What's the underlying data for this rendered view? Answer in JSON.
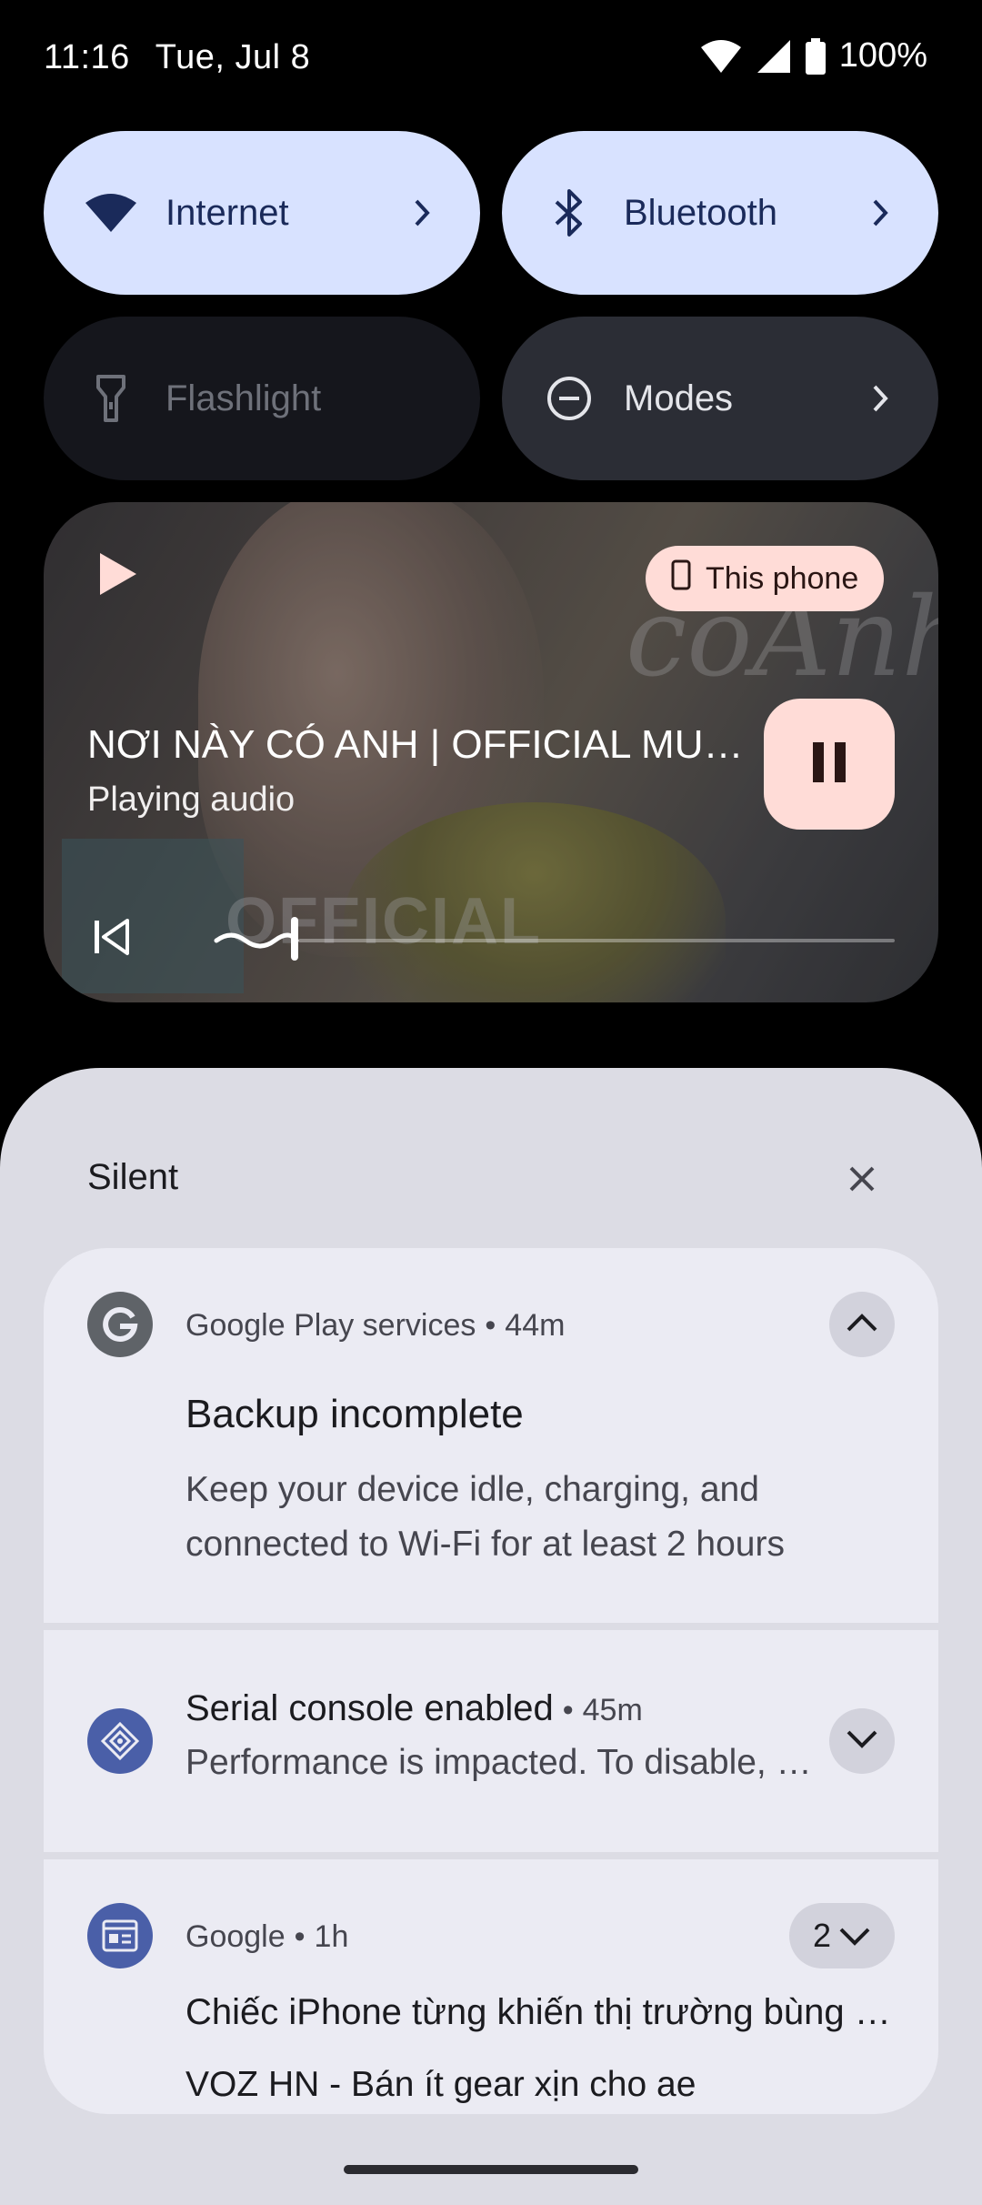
{
  "status_bar": {
    "time": "11:16",
    "date": "Tue, Jul 8",
    "battery": "100%"
  },
  "tiles": [
    {
      "label": "Internet",
      "icon": "wifi-icon"
    },
    {
      "label": "Bluetooth",
      "icon": "bluetooth-icon"
    },
    {
      "label": "Flashlight",
      "icon": "flashlight-icon"
    },
    {
      "label": "Modes",
      "icon": "modes-icon"
    }
  ],
  "media": {
    "output": "This phone",
    "title": "NƠI NÀY CÓ ANH | OFFICIAL MUSIC VIDEO",
    "subtitle": "Playing audio",
    "art_text": "OFFICIAL",
    "art_script": "cóAnh",
    "progress": 0.1
  },
  "notifications_header": {
    "title": "Silent"
  },
  "notifications": [
    {
      "app": "Google Play services",
      "time": "44m",
      "title": "Backup incomplete",
      "body_line1": "Keep your device idle, charging, and",
      "body_line2": "connected to Wi-Fi for at least 2 hours",
      "icon": "google-g-icon"
    },
    {
      "title": "Serial console enabled",
      "time": "45m",
      "body": "Performance is impacted. To disable, check bootloader",
      "icon": "serial-console-icon"
    },
    {
      "app": "Google",
      "time": "1h",
      "count": "2",
      "title": "Chiếc iPhone từng khiến thị trường bùng nổ",
      "body": "VOZ  HN - Bán ít gear xịn cho ae",
      "icon": "google-news-icon"
    }
  ],
  "colors": {
    "tile_active": "#d8e2ff",
    "tile_inactive": "#15161c",
    "tile_neutral": "#2b2d35",
    "media_accent": "#ffdcd7",
    "shade_bg": "#dcdce4",
    "notif_bg": "#ebebf3"
  }
}
